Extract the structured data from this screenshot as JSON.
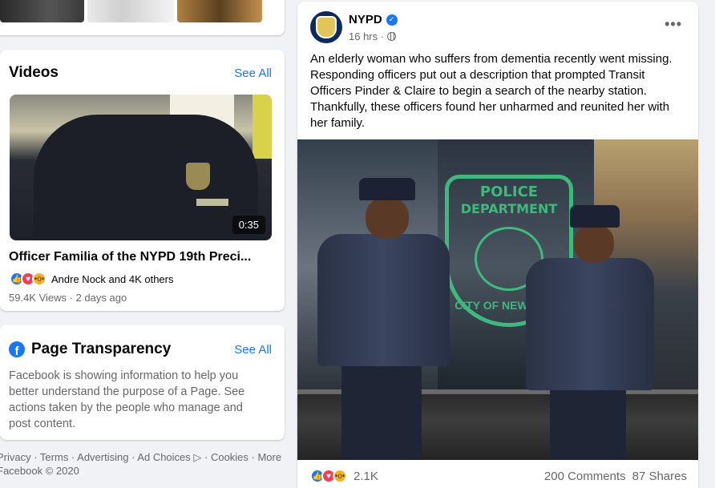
{
  "videos": {
    "title": "Videos",
    "see_all": "See All",
    "duration": "0:35",
    "video_title": "Officer Familia of the NYPD 19th Preci...",
    "reactions_text": "Andre Nock and 4K others",
    "meta": "59.4K Views · 2 days ago"
  },
  "transparency": {
    "title": "Page Transparency",
    "see_all": "See All",
    "body": "Facebook is showing information to help you better understand the purpose of a Page. See actions taken by the people who manage and post content."
  },
  "footer": {
    "links": "Privacy · Terms · Advertising · Ad Choices ▷ · Cookies · More",
    "copyright": "Facebook © 2020"
  },
  "post": {
    "author": "NYPD",
    "time": "16 hrs ·",
    "more": "•••",
    "text": "An elderly woman who suffers from dementia recently went missing. Responding officers put out a description that prompted Transit Officers Pinder & Claire to begin a search of the nearby station. Thankfully, these officers found her unharmed and reunited her with her family.",
    "emblem_line1": "POLICE",
    "emblem_line2": "DEPARTMENT",
    "emblem_line3": "CITY OF NEW YORK",
    "reaction_count": "2.1K",
    "comments": "200 Comments",
    "shares": "87 Shares"
  },
  "colors": {
    "accent": "#1877f2",
    "background": "#f0f2f5",
    "secondary_text": "#65676b",
    "emblem": "#3fbf7f"
  }
}
